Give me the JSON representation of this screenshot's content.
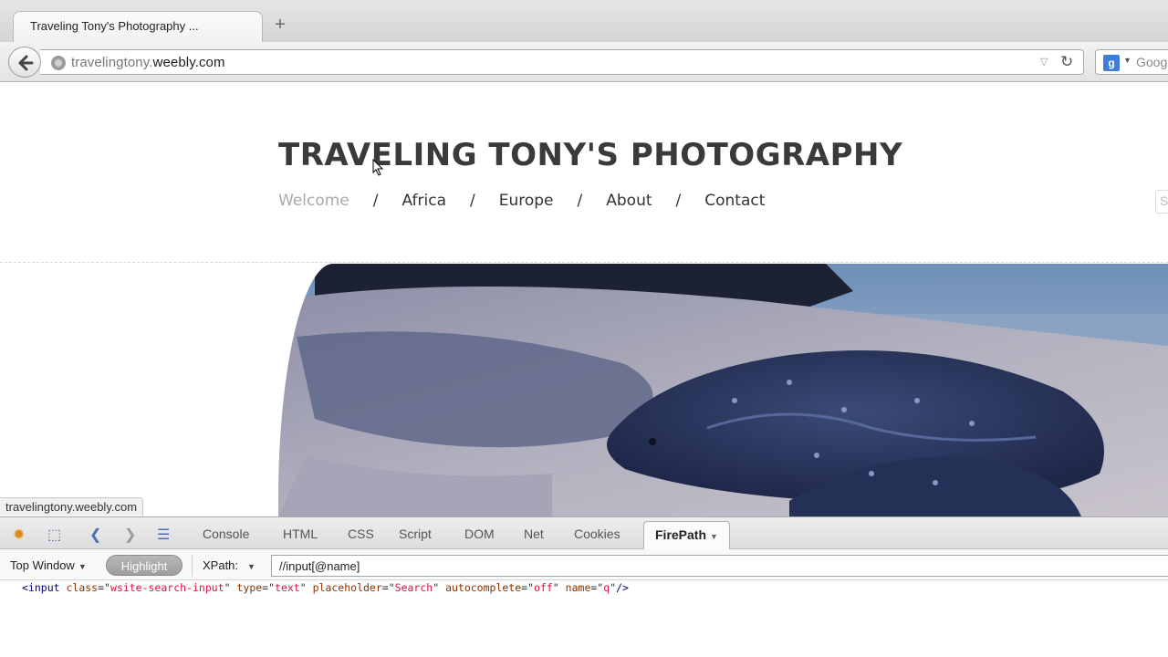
{
  "browser": {
    "tab_title": "Traveling Tony's Photography ...",
    "new_tab": "+",
    "url_host_prefix": "travelingtony.",
    "url_host_domain": "weebly.com",
    "search_engine_text": "Goog",
    "search_engine_icon": "g-icon"
  },
  "site": {
    "title": "TRAVELING TONY'S PHOTOGRAPHY",
    "nav": [
      "Welcome",
      "Africa",
      "Europe",
      "About",
      "Contact"
    ],
    "nav_separator": "/",
    "search_edge_text": "S",
    "active_nav": "Welcome"
  },
  "status_bar": "travelingtony.weebly.com",
  "firebug": {
    "tabs": [
      "Console",
      "HTML",
      "CSS",
      "Script",
      "DOM",
      "Net",
      "Cookies"
    ],
    "active_tab": "FirePath",
    "window_select": "Top Window",
    "highlight_label": "Highlight",
    "xpath_label": "XPath:",
    "xpath_value": "//input[@name]"
  },
  "result": {
    "tag_open": "<input",
    "attrs": [
      {
        "name": "class",
        "value": "wsite-search-input"
      },
      {
        "name": "type",
        "value": "text"
      },
      {
        "name": "placeholder",
        "value": "Search"
      },
      {
        "name": "autocomplete",
        "value": "off"
      },
      {
        "name": "name",
        "value": "q"
      }
    ],
    "tag_close": "/>"
  },
  "colors": {
    "nav_active": "#a9a9a9",
    "title": "#3a3a3a",
    "code_tag": "#000088",
    "code_attr": "#883300",
    "code_value": "#dd1144"
  }
}
